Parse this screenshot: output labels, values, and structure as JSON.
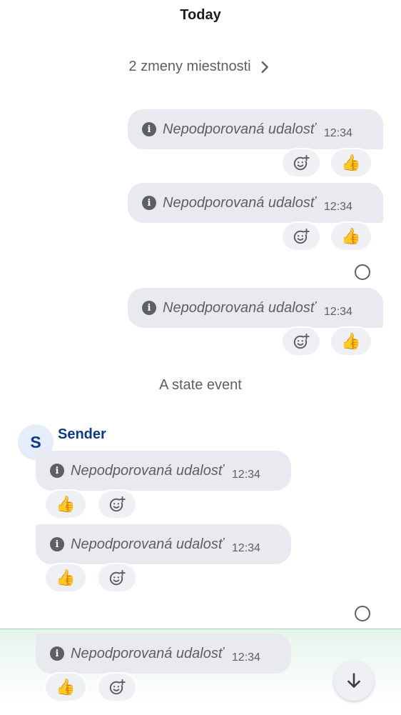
{
  "timeline": {
    "date_header": "Today",
    "room_changes_label": "2 zmeny miestnosti",
    "state_event_label": "A state event",
    "sender": {
      "name": "Sender",
      "avatar_initial": "S"
    },
    "unsupported_event_text": "Nepodporovaná udalosť",
    "time": "12:34"
  },
  "messages_outgoing": [
    {
      "text": "Nepodporovaná udalosť",
      "time": "12:34",
      "reaction": "👍"
    },
    {
      "text": "Nepodporovaná udalosť",
      "time": "12:34",
      "reaction": "👍"
    },
    {
      "text": "Nepodporovaná udalosť",
      "time": "12:34",
      "reaction": "👍"
    }
  ],
  "messages_incoming": [
    {
      "text": "Nepodporovaná udalosť",
      "time": "12:34",
      "reaction": "👍"
    },
    {
      "text": "Nepodporovaná udalosť",
      "time": "12:34",
      "reaction": "👍"
    },
    {
      "text": "Nepodporovaná udalosť",
      "time": "12:34",
      "reaction": "👍"
    }
  ],
  "icons": {
    "info": "info-icon",
    "add_reaction": "add-reaction-icon",
    "chevron": "chevron-right-icon",
    "scroll_down": "arrow-down-icon",
    "read_receipt": "read-receipt-icon"
  },
  "colors": {
    "bubble": "#e8eaef",
    "secondary_text": "#5c6066",
    "sender_name": "#0e3a84",
    "avatar_bg": "#e4edf9",
    "highlight_band": "#e6f4ec"
  }
}
